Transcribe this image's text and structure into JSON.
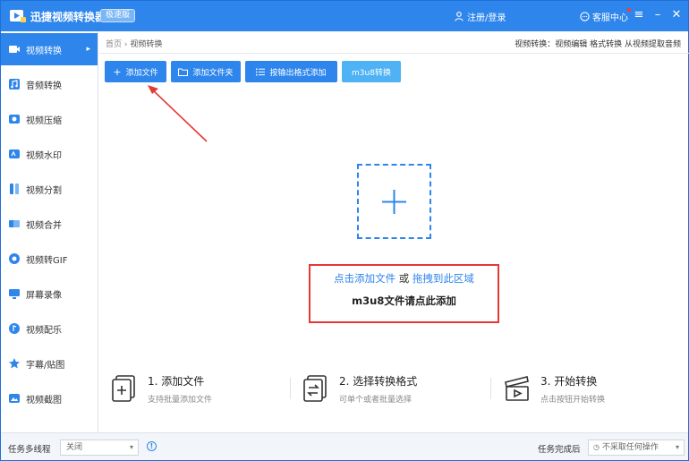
{
  "titlebar": {
    "app_title": "迅捷视频转换器",
    "edition_badge": "极速版",
    "login_label": "注册/登录",
    "support_label": "客服中心"
  },
  "sidebar": {
    "items": [
      {
        "label": "视频转换",
        "icon": "video-convert-icon",
        "active": true
      },
      {
        "label": "音频转换",
        "icon": "audio-convert-icon"
      },
      {
        "label": "视频压缩",
        "icon": "compress-icon"
      },
      {
        "label": "视频水印",
        "icon": "watermark-icon"
      },
      {
        "label": "视频分割",
        "icon": "split-icon"
      },
      {
        "label": "视频合并",
        "icon": "merge-icon"
      },
      {
        "label": "视频转GIF",
        "icon": "gif-icon"
      },
      {
        "label": "屏幕录像",
        "icon": "screen-record-icon"
      },
      {
        "label": "视频配乐",
        "icon": "music-icon"
      },
      {
        "label": "字幕/贴图",
        "icon": "subtitle-icon"
      },
      {
        "label": "视频截图",
        "icon": "screenshot-icon"
      }
    ]
  },
  "breadcrumb": {
    "home": "首页",
    "separator": "›",
    "current": "视频转换"
  },
  "top_links": "视频转换：视频编辑 格式转换 从视频提取音频",
  "toolbar": {
    "add_file": "添加文件",
    "add_folder": "添加文件夹",
    "by_format": "按输出格式添加",
    "m3u8": "m3u8转换"
  },
  "dropzone": {
    "click_add": "点击添加文件",
    "or": "或",
    "drag_here": "拖拽到此区域",
    "m3u8_hint": "m3u8文件请点此添加"
  },
  "steps": [
    {
      "title": "1. 添加文件",
      "desc": "支持批量添加文件"
    },
    {
      "title": "2. 选择转换格式",
      "desc": "可单个或者批量选择"
    },
    {
      "title": "3. 开始转换",
      "desc": "点击按钮开始转换"
    }
  ],
  "footer": {
    "multithread_label": "任务多线程",
    "multithread_value": "关闭",
    "done_label": "任务完成后",
    "done_value": "不采取任何操作"
  },
  "colors": {
    "primary": "#2e86ec",
    "annotation": "#e53935"
  }
}
